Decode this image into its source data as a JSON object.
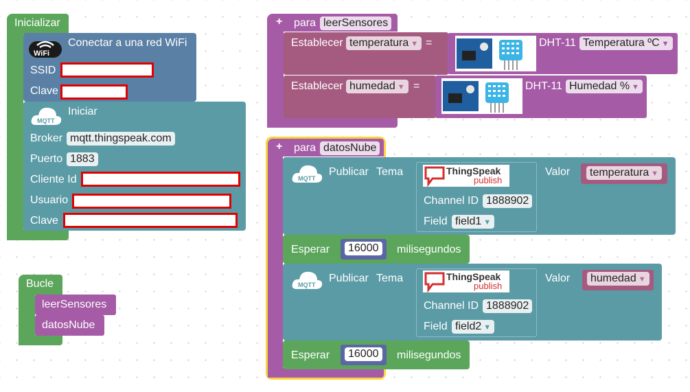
{
  "init_block": {
    "title": "Inicializar",
    "wifi": {
      "label": "Conectar a una red WiFi",
      "icon_text": "WiFi",
      "ssid_label": "SSID",
      "password_label": "Clave"
    },
    "mqtt": {
      "label": "Iniciar",
      "icon_text": "MQTT",
      "broker_label": "Broker",
      "broker_value": "mqtt.thingspeak.com",
      "port_label": "Puerto",
      "port_value": "1883",
      "client_label": "Cliente Id",
      "user_label": "Usuario",
      "password_label": "Clave"
    }
  },
  "loop_block": {
    "title": "Bucle",
    "calls": [
      "leerSensores",
      "datosNube"
    ]
  },
  "read_sensors": {
    "keyword": "para",
    "name": "leerSensores",
    "rows": [
      {
        "set_label": "Establecer",
        "variable": "temperatura",
        "sensor": "DHT-11",
        "measure": "Temperatura ºC"
      },
      {
        "set_label": "Establecer",
        "variable": "humedad",
        "sensor": "DHT-11",
        "measure": "Humedad %"
      }
    ],
    "equals": "="
  },
  "cloud_data": {
    "keyword": "para",
    "name": "datosNube",
    "publish": [
      {
        "label": "Publicar",
        "topic_label": "Tema",
        "logo_top": "ThingSpeak",
        "logo_bottom": "publish",
        "channel_label": "Channel ID",
        "channel_value": "1888902",
        "field_label": "Field",
        "field_value": "field1",
        "value_label": "Valor",
        "value_var": "temperatura"
      },
      {
        "label": "Publicar",
        "topic_label": "Tema",
        "logo_top": "ThingSpeak",
        "logo_bottom": "publish",
        "channel_label": "Channel ID",
        "channel_value": "1888902",
        "field_label": "Field",
        "field_value": "field2",
        "value_label": "Valor",
        "value_var": "humedad"
      }
    ],
    "wait": [
      {
        "label": "Esperar",
        "value": "16000",
        "unit": "milisegundos"
      },
      {
        "label": "Esperar",
        "value": "16000",
        "unit": "milisegundos"
      }
    ]
  },
  "colors": {
    "control": "#5BA65B",
    "mqtt": "#5B9BA6",
    "wifi": "#5B80A5",
    "procedure": "#A55BA5",
    "variables": "#A55B80",
    "number": "#5B67A5"
  },
  "icons": [
    "wifi-icon",
    "mqtt-cloud-icon",
    "dht11-sensor-icon",
    "thingspeak-logo",
    "dropdown-arrow-icon",
    "plus-icon"
  ]
}
